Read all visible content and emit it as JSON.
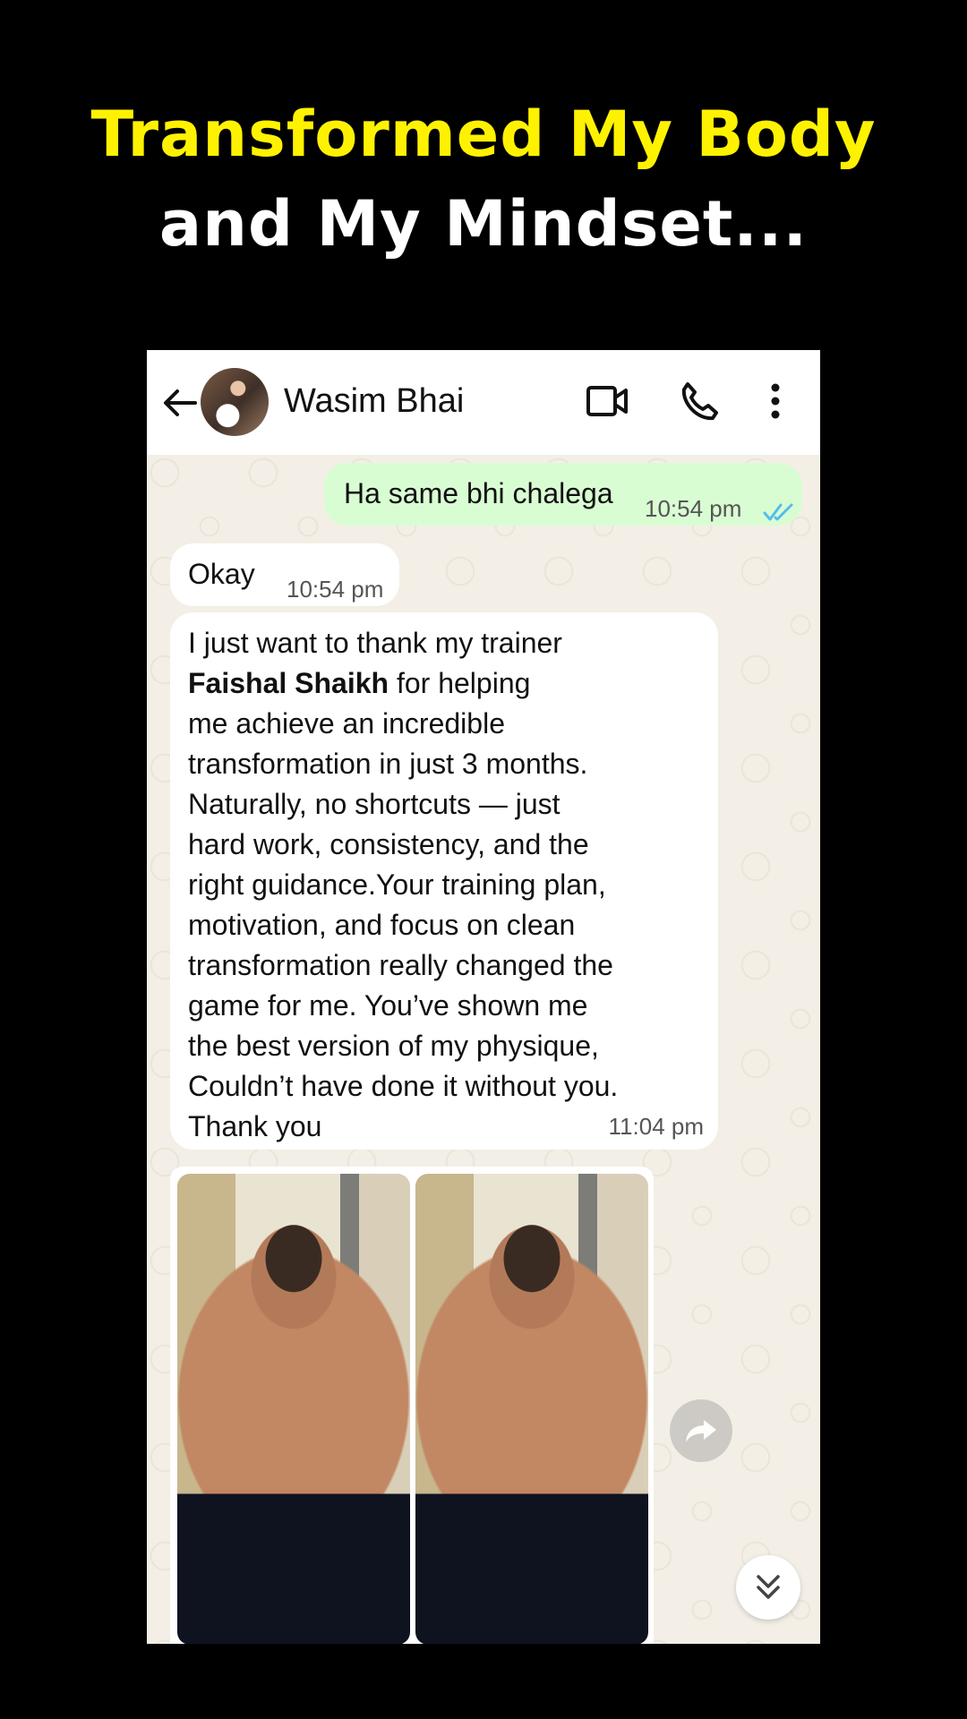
{
  "headline": {
    "line1": "Transformed My Body",
    "line2": "and My Mindset..."
  },
  "chat": {
    "contact_name": "Wasim Bhai",
    "messages": [
      {
        "direction": "outgoing",
        "text": "Ha same bhi chalega",
        "time": "10:54 pm",
        "status": "read"
      },
      {
        "direction": "incoming",
        "text": "Okay",
        "time": "10:54 pm"
      },
      {
        "direction": "incoming",
        "text_before_bold": "I just want to thank my trainer\n",
        "bold": "Faishal Shaikh",
        "text_after_bold": " for helping\nme achieve an incredible\ntransformation in just 3 months.\nNaturally, no shortcuts — just\nhard work, consistency, and the\nright guidance.Your training plan,\nmotivation, and focus on clean\ntransformation really changed the\ngame for me. You’ve shown me\nthe best version of my physique,\nCouldn’t have done it without you.\nThank you",
        "time": "11:04 pm"
      }
    ]
  },
  "colors": {
    "headline_yellow": "#FFF200",
    "outgoing_bubble": "#D9FDD3",
    "read_ticks": "#53BDEB",
    "chat_background": "#F3EFE6"
  },
  "icons": [
    "back-arrow-icon",
    "video-call-icon",
    "phone-icon",
    "more-options-icon",
    "forward-icon",
    "scroll-down-icon",
    "double-check-icon"
  ]
}
